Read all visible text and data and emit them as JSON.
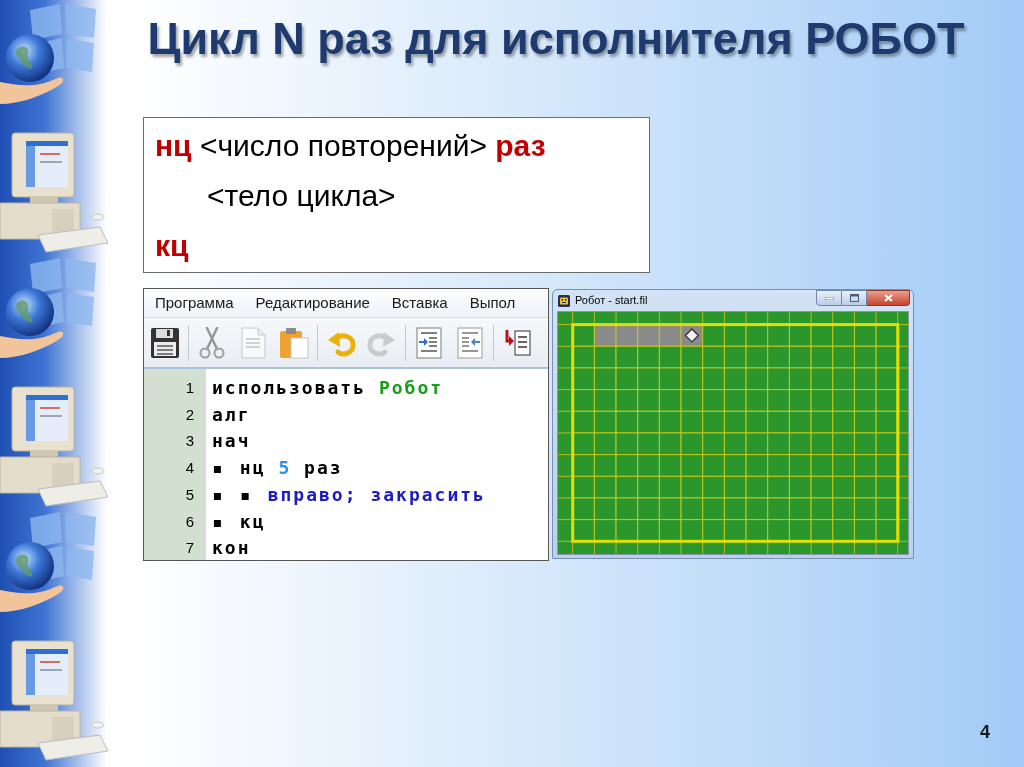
{
  "slide": {
    "title": "Цикл N раз для исполнителя РОБОТ",
    "page_number": "4"
  },
  "syntax_box": {
    "lines": [
      {
        "text": "**нц** <число повторений> **раз**",
        "kind": "mixed",
        "children": [
          {
            "text": "<тело цикла>",
            "kind": "plain"
          }
        ]
      },
      {
        "text": "кц",
        "kind": "keyword"
      }
    ]
  },
  "editor": {
    "menu": [
      "Программа",
      "Редактирование",
      "Вставка",
      "Выпол"
    ],
    "toolbar": [
      {
        "buttons": [
          {
            "kind": "save",
            "disabled": false
          }
        ]
      },
      {
        "buttons": [
          {
            "kind": "cut",
            "disabled": true
          },
          {
            "kind": "copy",
            "disabled": true
          },
          {
            "kind": "paste",
            "disabled": false
          }
        ]
      },
      {
        "buttons": [
          {
            "kind": "undo",
            "disabled": false
          },
          {
            "kind": "redo",
            "disabled": true
          }
        ]
      },
      {
        "buttons": [
          {
            "kind": "indent",
            "disabled": false
          },
          {
            "kind": "unindent",
            "disabled": false
          }
        ]
      },
      {
        "buttons": [
          {
            "kind": "step",
            "disabled": false
          }
        ]
      }
    ],
    "code": [
      {
        "number": "1",
        "tokens": [
          {
            "text": "использовать",
            "kind": "keyword"
          },
          {
            "text": "Робот",
            "kind": "module"
          }
        ]
      },
      {
        "number": "2",
        "tokens": [
          {
            "text": "алг",
            "kind": "keyword"
          }
        ]
      },
      {
        "number": "3",
        "tokens": [
          {
            "text": "нач",
            "kind": "keyword"
          }
        ]
      },
      {
        "number": "4",
        "tokens": [
          {
            "text": "▪",
            "kind": "indent"
          },
          {
            "text": "нц",
            "kind": "keyword"
          },
          {
            "text": "5",
            "kind": "number"
          },
          {
            "text": "раз",
            "kind": "keyword"
          }
        ]
      },
      {
        "number": "5",
        "tokens": [
          {
            "text": "▪",
            "kind": "indent"
          },
          {
            "text": "▪",
            "kind": "indent"
          },
          {
            "text": "вправо; закрасить",
            "kind": "command"
          }
        ]
      },
      {
        "number": "6",
        "tokens": [
          {
            "text": "▪",
            "kind": "indent"
          },
          {
            "text": "кц",
            "kind": "keyword"
          }
        ]
      },
      {
        "number": "7",
        "tokens": [
          {
            "text": "кон",
            "kind": "keyword"
          }
        ]
      }
    ]
  },
  "robot_window": {
    "title": "Робот - start.fil",
    "field": {
      "rows": [
        {
          "cells": [
            {
              "painted": false,
              "robot": false
            },
            {
              "painted": true,
              "robot": false
            },
            {
              "painted": true,
              "robot": false
            },
            {
              "painted": true,
              "robot": false
            },
            {
              "painted": true,
              "robot": false
            },
            {
              "painted": true,
              "robot": true
            },
            {
              "painted": false,
              "robot": false
            },
            {
              "painted": false,
              "robot": false
            },
            {
              "painted": false,
              "robot": false
            },
            {
              "painted": false,
              "robot": false
            },
            {
              "painted": false,
              "robot": false
            },
            {
              "painted": false,
              "robot": false
            },
            {
              "painted": false,
              "robot": false
            },
            {
              "painted": false,
              "robot": false
            },
            {
              "painted": false,
              "robot": false
            }
          ]
        },
        {
          "cells": [
            {
              "painted": false,
              "robot": false
            },
            {
              "painted": false,
              "robot": false
            },
            {
              "painted": false,
              "robot": false
            },
            {
              "painted": false,
              "robot": false
            },
            {
              "painted": false,
              "robot": false
            },
            {
              "painted": false,
              "robot": false
            },
            {
              "painted": false,
              "robot": false
            },
            {
              "painted": false,
              "robot": false
            },
            {
              "painted": false,
              "robot": false
            },
            {
              "painted": false,
              "robot": false
            },
            {
              "painted": false,
              "robot": false
            },
            {
              "painted": false,
              "robot": false
            },
            {
              "painted": false,
              "robot": false
            },
            {
              "painted": false,
              "robot": false
            },
            {
              "painted": false,
              "robot": false
            }
          ]
        },
        {
          "cells": [
            {
              "painted": false,
              "robot": false
            },
            {
              "painted": false,
              "robot": false
            },
            {
              "painted": false,
              "robot": false
            },
            {
              "painted": false,
              "robot": false
            },
            {
              "painted": false,
              "robot": false
            },
            {
              "painted": false,
              "robot": false
            },
            {
              "painted": false,
              "robot": false
            },
            {
              "painted": false,
              "robot": false
            },
            {
              "painted": false,
              "robot": false
            },
            {
              "painted": false,
              "robot": false
            },
            {
              "painted": false,
              "robot": false
            },
            {
              "painted": false,
              "robot": false
            },
            {
              "painted": false,
              "robot": false
            },
            {
              "painted": false,
              "robot": false
            },
            {
              "painted": false,
              "robot": false
            }
          ]
        },
        {
          "cells": [
            {
              "painted": false,
              "robot": false
            },
            {
              "painted": false,
              "robot": false
            },
            {
              "painted": false,
              "robot": false
            },
            {
              "painted": false,
              "robot": false
            },
            {
              "painted": false,
              "robot": false
            },
            {
              "painted": false,
              "robot": false
            },
            {
              "painted": false,
              "robot": false
            },
            {
              "painted": false,
              "robot": false
            },
            {
              "painted": false,
              "robot": false
            },
            {
              "painted": false,
              "robot": false
            },
            {
              "painted": false,
              "robot": false
            },
            {
              "painted": false,
              "robot": false
            },
            {
              "painted": false,
              "robot": false
            },
            {
              "painted": false,
              "robot": false
            },
            {
              "painted": false,
              "robot": false
            }
          ]
        },
        {
          "cells": [
            {
              "painted": false,
              "robot": false
            },
            {
              "painted": false,
              "robot": false
            },
            {
              "painted": false,
              "robot": false
            },
            {
              "painted": false,
              "robot": false
            },
            {
              "painted": false,
              "robot": false
            },
            {
              "painted": false,
              "robot": false
            },
            {
              "painted": false,
              "robot": false
            },
            {
              "painted": false,
              "robot": false
            },
            {
              "painted": false,
              "robot": false
            },
            {
              "painted": false,
              "robot": false
            },
            {
              "painted": false,
              "robot": false
            },
            {
              "painted": false,
              "robot": false
            },
            {
              "painted": false,
              "robot": false
            },
            {
              "painted": false,
              "robot": false
            },
            {
              "painted": false,
              "robot": false
            }
          ]
        },
        {
          "cells": [
            {
              "painted": false,
              "robot": false
            },
            {
              "painted": false,
              "robot": false
            },
            {
              "painted": false,
              "robot": false
            },
            {
              "painted": false,
              "robot": false
            },
            {
              "painted": false,
              "robot": false
            },
            {
              "painted": false,
              "robot": false
            },
            {
              "painted": false,
              "robot": false
            },
            {
              "painted": false,
              "robot": false
            },
            {
              "painted": false,
              "robot": false
            },
            {
              "painted": false,
              "robot": false
            },
            {
              "painted": false,
              "robot": false
            },
            {
              "painted": false,
              "robot": false
            },
            {
              "painted": false,
              "robot": false
            },
            {
              "painted": false,
              "robot": false
            },
            {
              "painted": false,
              "robot": false
            }
          ]
        },
        {
          "cells": [
            {
              "painted": false,
              "robot": false
            },
            {
              "painted": false,
              "robot": false
            },
            {
              "painted": false,
              "robot": false
            },
            {
              "painted": false,
              "robot": false
            },
            {
              "painted": false,
              "robot": false
            },
            {
              "painted": false,
              "robot": false
            },
            {
              "painted": false,
              "robot": false
            },
            {
              "painted": false,
              "robot": false
            },
            {
              "painted": false,
              "robot": false
            },
            {
              "painted": false,
              "robot": false
            },
            {
              "painted": false,
              "robot": false
            },
            {
              "painted": false,
              "robot": false
            },
            {
              "painted": false,
              "robot": false
            },
            {
              "painted": false,
              "robot": false
            },
            {
              "painted": false,
              "robot": false
            }
          ]
        },
        {
          "cells": [
            {
              "painted": false,
              "robot": false
            },
            {
              "painted": false,
              "robot": false
            },
            {
              "painted": false,
              "robot": false
            },
            {
              "painted": false,
              "robot": false
            },
            {
              "painted": false,
              "robot": false
            },
            {
              "painted": false,
              "robot": false
            },
            {
              "painted": false,
              "robot": false
            },
            {
              "painted": false,
              "robot": false
            },
            {
              "painted": false,
              "robot": false
            },
            {
              "painted": false,
              "robot": false
            },
            {
              "painted": false,
              "robot": false
            },
            {
              "painted": false,
              "robot": false
            },
            {
              "painted": false,
              "robot": false
            },
            {
              "painted": false,
              "robot": false
            },
            {
              "painted": false,
              "robot": false
            }
          ]
        },
        {
          "cells": [
            {
              "painted": false,
              "robot": false
            },
            {
              "painted": false,
              "robot": false
            },
            {
              "painted": false,
              "robot": false
            },
            {
              "painted": false,
              "robot": false
            },
            {
              "painted": false,
              "robot": false
            },
            {
              "painted": false,
              "robot": false
            },
            {
              "painted": false,
              "robot": false
            },
            {
              "painted": false,
              "robot": false
            },
            {
              "painted": false,
              "robot": false
            },
            {
              "painted": false,
              "robot": false
            },
            {
              "painted": false,
              "robot": false
            },
            {
              "painted": false,
              "robot": false
            },
            {
              "painted": false,
              "robot": false
            },
            {
              "painted": false,
              "robot": false
            },
            {
              "painted": false,
              "robot": false
            }
          ]
        },
        {
          "cells": [
            {
              "painted": false,
              "robot": false
            },
            {
              "painted": false,
              "robot": false
            },
            {
              "painted": false,
              "robot": false
            },
            {
              "painted": false,
              "robot": false
            },
            {
              "painted": false,
              "robot": false
            },
            {
              "painted": false,
              "robot": false
            },
            {
              "painted": false,
              "robot": false
            },
            {
              "painted": false,
              "robot": false
            },
            {
              "painted": false,
              "robot": false
            },
            {
              "painted": false,
              "robot": false
            },
            {
              "painted": false,
              "robot": false
            },
            {
              "painted": false,
              "robot": false
            },
            {
              "painted": false,
              "robot": false
            },
            {
              "painted": false,
              "robot": false
            },
            {
              "painted": false,
              "robot": false
            }
          ]
        }
      ]
    }
  }
}
